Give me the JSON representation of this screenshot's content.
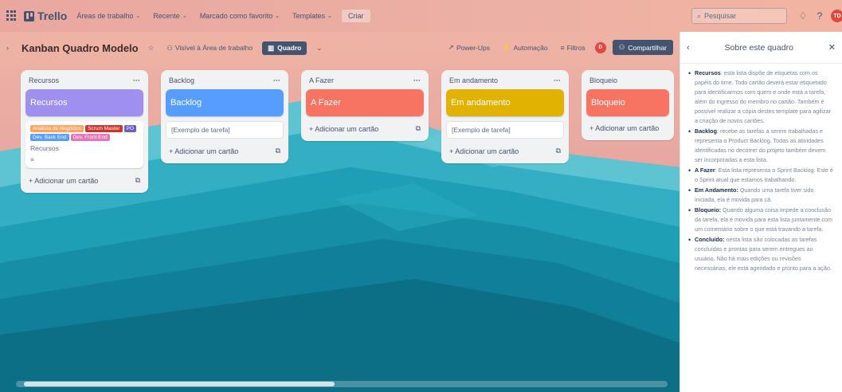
{
  "topbar": {
    "app_name": "Trello",
    "nav": [
      {
        "label": "Áreas de trabalho"
      },
      {
        "label": "Recente"
      },
      {
        "label": "Marcado como favorito"
      },
      {
        "label": "Templates"
      }
    ],
    "create_label": "Criar",
    "search_placeholder": "Pesquisar",
    "avatar_initials": "TD"
  },
  "board": {
    "title": "Kanban Quadro Modelo",
    "visibility": "Visível à Área de trabalho",
    "view_label": "Quadro",
    "powerups": "Power-Ups",
    "automation": "Automação",
    "filters": "Filtros",
    "avatar_initials": "D",
    "share_label": "Compartilhar"
  },
  "colors": {
    "purple": "#9f8fef",
    "blue": "#579dff",
    "red": "#f87462",
    "yellow": "#e2b203",
    "orange": "#fea362",
    "darkred": "#c9372c",
    "midblue": "#579dff",
    "pink": "#e774bb"
  },
  "lists": [
    {
      "name": "Recursos",
      "card_title": "Recursos",
      "cover_color": "#9f8fef",
      "labels": [
        {
          "text": "Analista de Negócios",
          "color": "#fea362"
        },
        {
          "text": "Scrum Master",
          "color": "#c9372c"
        },
        {
          "text": "PO",
          "color": "#6e5dc6"
        },
        {
          "text": "Dev. Back End",
          "color": "#579dff"
        },
        {
          "text": "Dev. Front End",
          "color": "#e774bb"
        }
      ],
      "card_subtitle": "Recursos",
      "add_card": "Adicionar um cartão"
    },
    {
      "name": "Backlog",
      "card_title": "Backlog",
      "cover_color": "#579dff",
      "placeholder": "[Exemplo de tarefa]",
      "add_card": "Adicionar um cartão"
    },
    {
      "name": "A Fazer",
      "card_title": "A Fazer",
      "cover_color": "#f87462",
      "add_card": "Adicionar um cartão"
    },
    {
      "name": "Em andamento",
      "card_title": "Em andamento",
      "cover_color": "#e2b203",
      "placeholder": "[Exemplo de tarefa]",
      "add_card": "Adicionar um cartão"
    },
    {
      "name": "Bloqueio",
      "card_title": "Bloqueio",
      "cover_color": "#f87462",
      "add_card": "Adicionar um cartão"
    }
  ],
  "panel": {
    "title": "Sobre este quadro",
    "items": [
      {
        "term": "Recursos",
        "text": ": esta lista dispõe de etiquetas com os papéis do time. Todo cartão deverá estar etiquetado para identificarmos com quem e onde está a tarefa, além do ingresso do membro no cartão. Também é possível realizar a cópia destes template para agilizar a criação de novos cartões."
      },
      {
        "term": "Backlog",
        "text": ": recebe as tarefas a serem trabalhadas e representa o Product Backlog. Todas as atividades identificadas no decorrer do projeto também devem ser incorporadas a esta lista."
      },
      {
        "term": "A Fazer",
        "text": ": Esta lista representa o Sprint Backlog. Este é o Sprint atual que estamos trabalhando."
      },
      {
        "term": "Em Andamento:",
        "text": " Quando uma tarefa tiver sido iniciada, ela é movida para cá."
      },
      {
        "term": "Bloqueio:",
        "text": " Quando alguma coisa impede a conclusão da tarefa, ela é movida para esta lista juntamente com um comentário sobre o que está travando a tarefa."
      },
      {
        "term": "Concluído:",
        "text": " nesta lista são colocadas as tarefas concluídas e prontas para serem entregues ao usuário. Não há mais edições ou revisões necessárias, ele está agendado e pronto para a ação."
      }
    ]
  }
}
